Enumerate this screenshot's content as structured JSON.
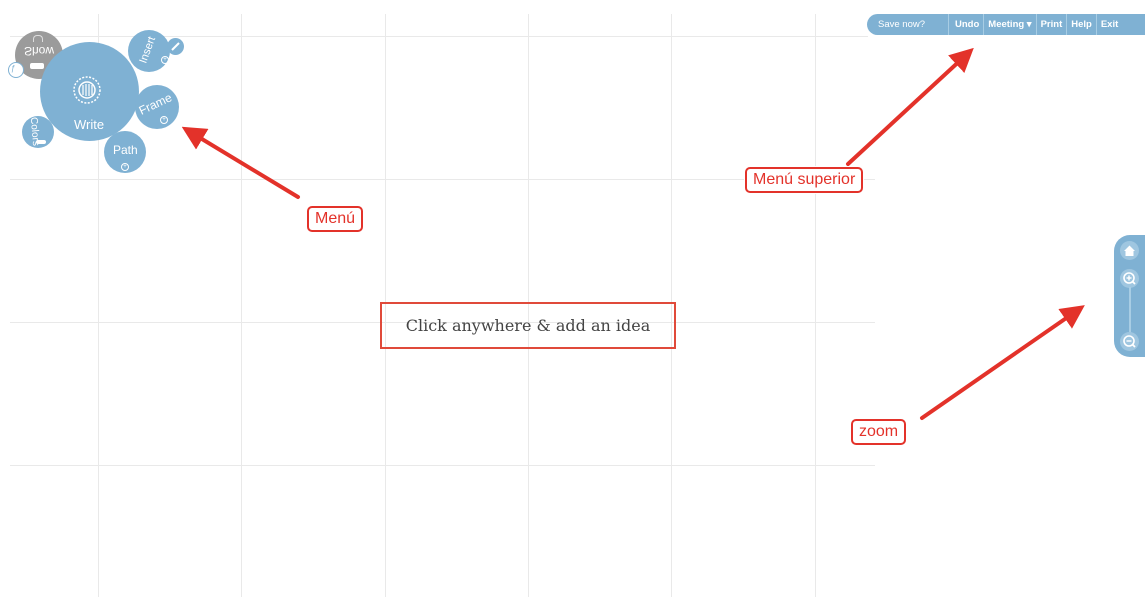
{
  "menu": {
    "write": "Write",
    "insert": "Insert",
    "frame": "Frame",
    "path": "Path",
    "colors": "Colors",
    "show": "Show"
  },
  "topbar": {
    "save_now": "Save now?",
    "undo": "Undo",
    "meeting": "Meeting ▾",
    "print": "Print",
    "help": "Help",
    "exit": "Exit"
  },
  "canvas": {
    "prompt": "Click anywhere & add an idea"
  },
  "annotations": {
    "menu": "Menú",
    "top_menu": "Menú superior",
    "zoom": "zoom"
  },
  "zoom": {
    "home_icon": "home-icon",
    "zoom_in_icon": "zoom-in-icon",
    "zoom_out_icon": "zoom-out-icon"
  },
  "colors": {
    "accent": "#7fb1d3",
    "annotation": "#e3322a",
    "grid": "#e9e9e9"
  }
}
